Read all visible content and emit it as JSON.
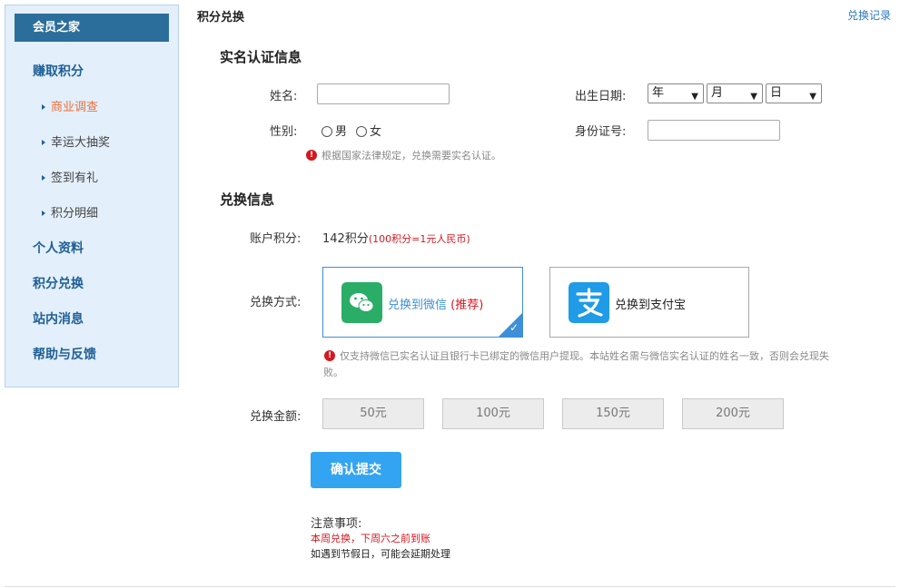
{
  "sidebar": {
    "header": "会员之家",
    "items": [
      {
        "label": "赚取积分"
      },
      {
        "label": "商业调查",
        "sub": true,
        "active": true
      },
      {
        "label": "幸运大抽奖",
        "sub": true
      },
      {
        "label": "签到有礼",
        "sub": true
      },
      {
        "label": "积分明细",
        "sub": true
      },
      {
        "label": "个人资料"
      },
      {
        "label": "积分兑换"
      },
      {
        "label": "站内消息"
      },
      {
        "label": "帮助与反馈"
      }
    ]
  },
  "header": {
    "title": "积分兑换",
    "record_link": "兑换记录"
  },
  "identity": {
    "section_title": "实名认证信息",
    "name_label": "姓名:",
    "name_value": "",
    "birth_label": "出生日期:",
    "year": "年",
    "month": "月",
    "day": "日",
    "gender_label": "性别:",
    "male": "男",
    "female": "女",
    "id_label": "身份证号:",
    "id_value": "",
    "notice": "根据国家法律规定，兑换需要实名认证。"
  },
  "exchange": {
    "section_title": "兑换信息",
    "points_label": "账户积分:",
    "points_value": "142积分",
    "rate": "(100积分=1元人民币)",
    "method_label": "兑换方式:",
    "wechat_text": "兑换到微信",
    "wechat_tag": "(推荐)",
    "alipay_text": "兑换到支付宝",
    "method_notice": "仅支持微信已实名认证且银行卡已绑定的微信用户提现。本站姓名需与微信实名认证的姓名一致，否则会兑现失",
    "method_notice_2": "败。",
    "amount_label": "兑换金额:",
    "amounts": [
      "50元",
      "100元",
      "150元",
      "200元"
    ],
    "submit": "确认提交"
  },
  "notes": {
    "title": "注意事项:",
    "line1": "本周兑换，下周六之前到账",
    "line2": "如遇到节假日，可能会延期处理"
  },
  "colors": {
    "accent": "#33a4f2",
    "sidebar_bg": "#e3effa",
    "sidebar_header": "#2b6e9b",
    "active_item": "#f0703c",
    "warn": "#d9161e",
    "wechat": "#2aae67",
    "alipay": "#1f9be8"
  },
  "icons": {
    "wechat": "wechat-icon",
    "alipay": "alipay-icon",
    "warning": "warning-icon",
    "check": "check-icon"
  }
}
